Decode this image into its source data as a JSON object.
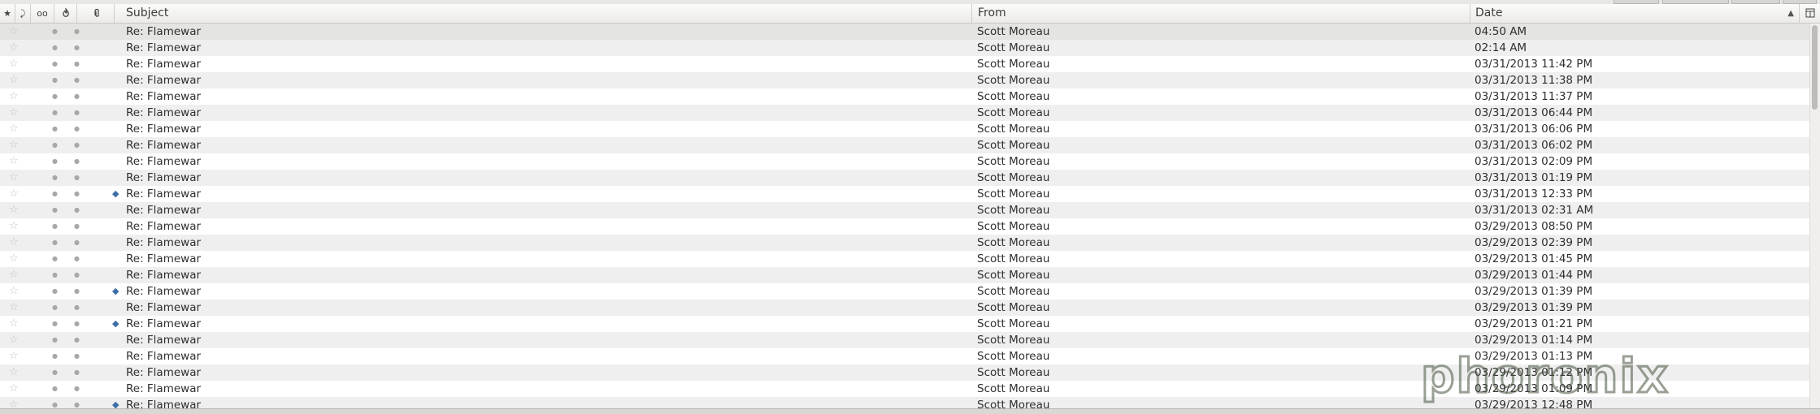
{
  "columns": {
    "star_icon": "★",
    "thread_icon": "⤸",
    "read_icon": "oo",
    "junk_icon": "flame-icon",
    "attachment_icon": "paperclip-icon",
    "subject": "Subject",
    "from": "From",
    "date": "Date",
    "sort_indicator": "▲"
  },
  "watermark": "phoronix",
  "messages": [
    {
      "subject": "Re: Flamewar",
      "from": "Scott Moreau",
      "date": "04:50 AM",
      "tagged": false
    },
    {
      "subject": "Re: Flamewar",
      "from": "Scott Moreau",
      "date": "02:14 AM",
      "tagged": false
    },
    {
      "subject": "Re: Flamewar",
      "from": "Scott Moreau",
      "date": "03/31/2013 11:42 PM",
      "tagged": false
    },
    {
      "subject": "Re: Flamewar",
      "from": "Scott Moreau",
      "date": "03/31/2013 11:38 PM",
      "tagged": false
    },
    {
      "subject": "Re: Flamewar",
      "from": "Scott Moreau",
      "date": "03/31/2013 11:37 PM",
      "tagged": false
    },
    {
      "subject": "Re: Flamewar",
      "from": "Scott Moreau",
      "date": "03/31/2013 06:44 PM",
      "tagged": false
    },
    {
      "subject": "Re: Flamewar",
      "from": "Scott Moreau",
      "date": "03/31/2013 06:06 PM",
      "tagged": false
    },
    {
      "subject": "Re: Flamewar",
      "from": "Scott Moreau",
      "date": "03/31/2013 06:02 PM",
      "tagged": false
    },
    {
      "subject": "Re: Flamewar",
      "from": "Scott Moreau",
      "date": "03/31/2013 02:09 PM",
      "tagged": false
    },
    {
      "subject": "Re: Flamewar",
      "from": "Scott Moreau",
      "date": "03/31/2013 01:19 PM",
      "tagged": false
    },
    {
      "subject": "Re: Flamewar",
      "from": "Scott Moreau",
      "date": "03/31/2013 12:33 PM",
      "tagged": true
    },
    {
      "subject": "Re: Flamewar",
      "from": "Scott Moreau",
      "date": "03/31/2013 02:31 AM",
      "tagged": false
    },
    {
      "subject": "Re: Flamewar",
      "from": "Scott Moreau",
      "date": "03/29/2013 08:50 PM",
      "tagged": false
    },
    {
      "subject": "Re: Flamewar",
      "from": "Scott Moreau",
      "date": "03/29/2013 02:39 PM",
      "tagged": false
    },
    {
      "subject": "Re: Flamewar",
      "from": "Scott Moreau",
      "date": "03/29/2013 01:45 PM",
      "tagged": false
    },
    {
      "subject": "Re: Flamewar",
      "from": "Scott Moreau",
      "date": "03/29/2013 01:44 PM",
      "tagged": false
    },
    {
      "subject": "Re: Flamewar",
      "from": "Scott Moreau",
      "date": "03/29/2013 01:39 PM",
      "tagged": true
    },
    {
      "subject": "Re: Flamewar",
      "from": "Scott Moreau",
      "date": "03/29/2013 01:39 PM",
      "tagged": false
    },
    {
      "subject": "Re: Flamewar",
      "from": "Scott Moreau",
      "date": "03/29/2013 01:21 PM",
      "tagged": true
    },
    {
      "subject": "Re: Flamewar",
      "from": "Scott Moreau",
      "date": "03/29/2013 01:14 PM",
      "tagged": false
    },
    {
      "subject": "Re: Flamewar",
      "from": "Scott Moreau",
      "date": "03/29/2013 01:13 PM",
      "tagged": false
    },
    {
      "subject": "Re: Flamewar",
      "from": "Scott Moreau",
      "date": "03/29/2013 01:12 PM",
      "tagged": false
    },
    {
      "subject": "Re: Flamewar",
      "from": "Scott Moreau",
      "date": "03/29/2013 01:09 PM",
      "tagged": false
    },
    {
      "subject": "Re: Flamewar",
      "from": "Scott Moreau",
      "date": "03/29/2013 12:48 PM",
      "tagged": true
    }
  ]
}
